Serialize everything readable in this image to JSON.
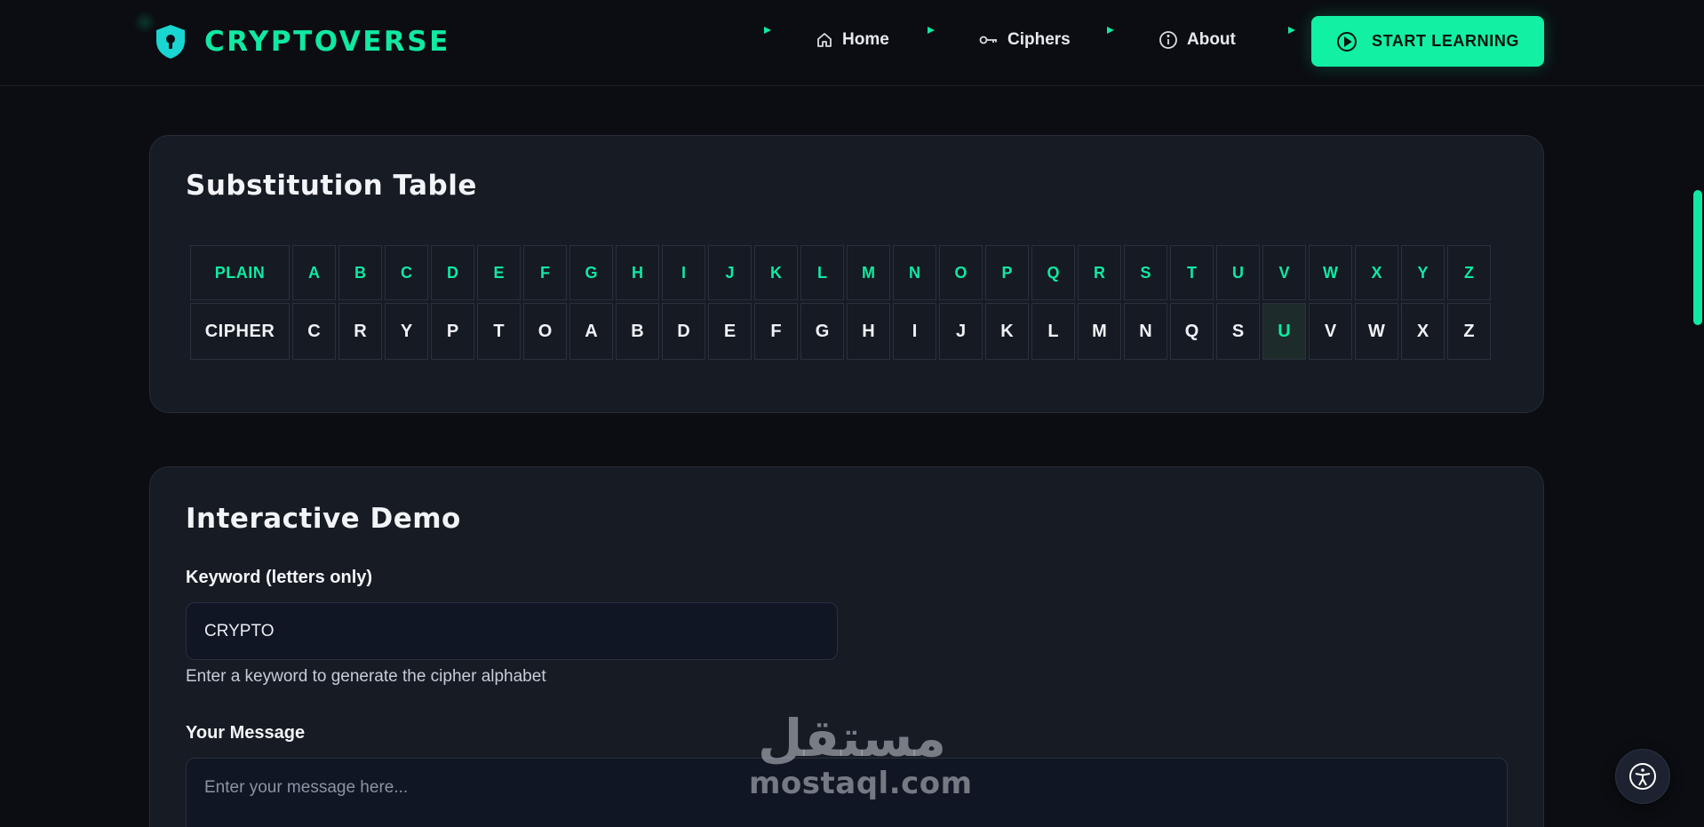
{
  "brand": {
    "name": "CRYPTOVERSE",
    "icon": "shield-lock-icon"
  },
  "nav": {
    "links": [
      {
        "label": "Home",
        "icon": "home-icon"
      },
      {
        "label": "Ciphers",
        "icon": "key-icon"
      },
      {
        "label": "About",
        "icon": "info-icon"
      }
    ],
    "cta": {
      "label": "START LEARNING",
      "icon": "play-circle-icon"
    }
  },
  "substitution": {
    "title": "Substitution Table",
    "plain_label": "PLAIN",
    "cipher_label": "CIPHER",
    "plain": [
      "A",
      "B",
      "C",
      "D",
      "E",
      "F",
      "G",
      "H",
      "I",
      "J",
      "K",
      "L",
      "M",
      "N",
      "O",
      "P",
      "Q",
      "R",
      "S",
      "T",
      "U",
      "V",
      "W",
      "X",
      "Y",
      "Z"
    ],
    "cipher": [
      "C",
      "R",
      "Y",
      "P",
      "T",
      "O",
      "A",
      "B",
      "D",
      "E",
      "F",
      "G",
      "H",
      "I",
      "J",
      "K",
      "L",
      "M",
      "N",
      "Q",
      "S",
      "U",
      "V",
      "W",
      "X",
      "Z"
    ],
    "highlighted_index": 21
  },
  "demo": {
    "title": "Interactive Demo",
    "keyword_label": "Keyword (letters only)",
    "keyword_value": "CRYPTO",
    "keyword_hint": "Enter a keyword to generate the cipher alphabet",
    "message_label": "Your Message",
    "message_placeholder": "Enter your message here..."
  },
  "watermark": {
    "arabic": "مستقل",
    "latin": "mostaql.com"
  },
  "colors": {
    "accent": "#10e9a1",
    "background": "#0b0d12",
    "card": "#161b24"
  }
}
